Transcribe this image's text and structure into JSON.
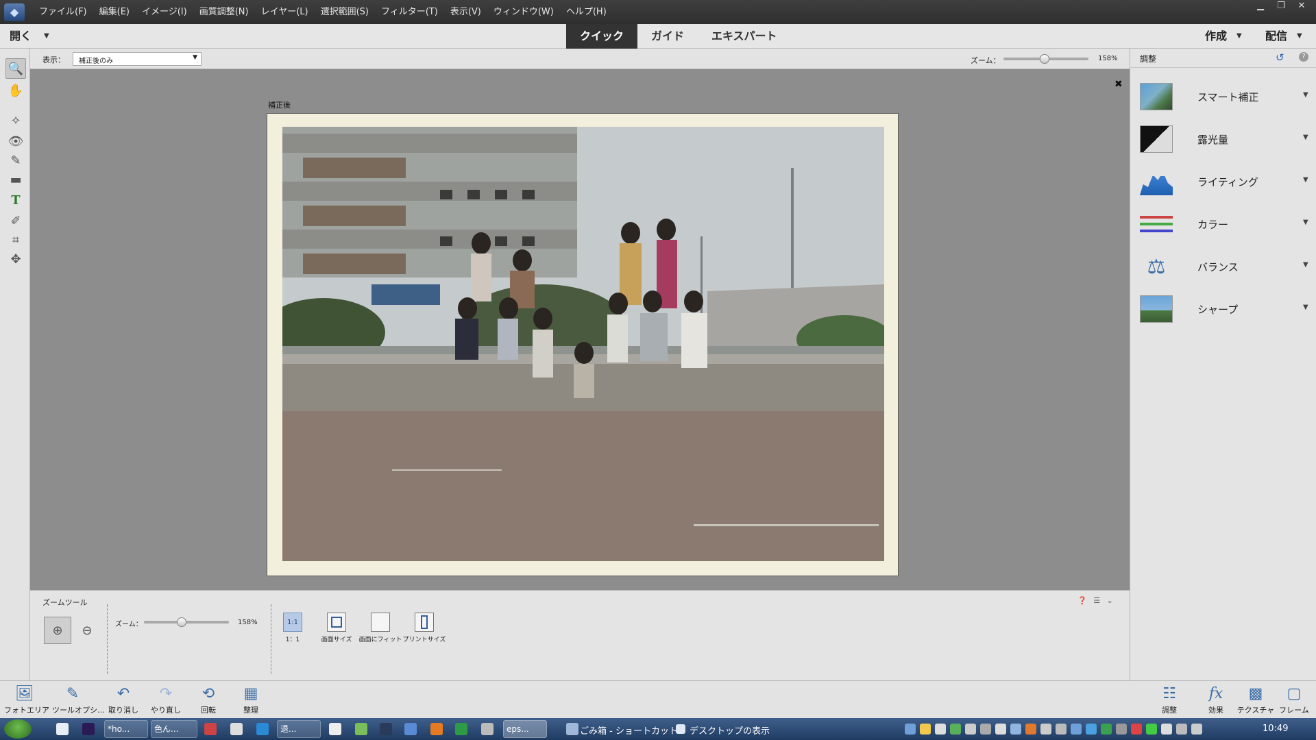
{
  "menubar": {
    "items": [
      "ファイル(F)",
      "編集(E)",
      "イメージ(I)",
      "画質調整(N)",
      "レイヤー(L)",
      "選択範囲(S)",
      "フィルター(T)",
      "表示(V)",
      "ウィンドウ(W)",
      "ヘルプ(H)"
    ]
  },
  "modebar": {
    "open_label": "開く",
    "tabs": [
      "クイック",
      "ガイド",
      "エキスパート"
    ],
    "active_tab": "クイック",
    "create_label": "作成",
    "share_label": "配信"
  },
  "viewbar": {
    "view_label": "表示：",
    "view_value": "補正後のみ",
    "zoom_label": "ズーム：",
    "zoom_value": "158%",
    "zoom_level": 0.48
  },
  "document": {
    "label": "補正後"
  },
  "tool_options": {
    "title": "ズームツール",
    "zoom_label": "ズーム：",
    "zoom_value": "158%",
    "zoom_level": 0.44,
    "view_buttons": [
      "1：1",
      "画面サイズ",
      "画面にフィット",
      "プリントサイズ"
    ],
    "one_to_one_icon": "1:1"
  },
  "right_panel": {
    "title": "調整",
    "items": [
      "スマート補正",
      "露光量",
      "ライティング",
      "カラー",
      "バランス",
      "シャープ"
    ]
  },
  "panel_bar": {
    "left": [
      "フォトエリア",
      "ツールオプシ…",
      "取り消し",
      "やり直し",
      "回転",
      "整理"
    ],
    "right": [
      "調整",
      "効果",
      "テクスチャ",
      "フレーム"
    ]
  },
  "taskbar": {
    "buttons": [
      "*ho...",
      "色ん...",
      "退...",
      "eps..."
    ],
    "shortcut_recycle": "ごみ箱 - ショートカット",
    "shortcut_desktop": "デスクトップの表示",
    "clock": "10:49"
  },
  "colors": {
    "active_tab_bg": "#333333",
    "accent": "#3a6ea8"
  }
}
